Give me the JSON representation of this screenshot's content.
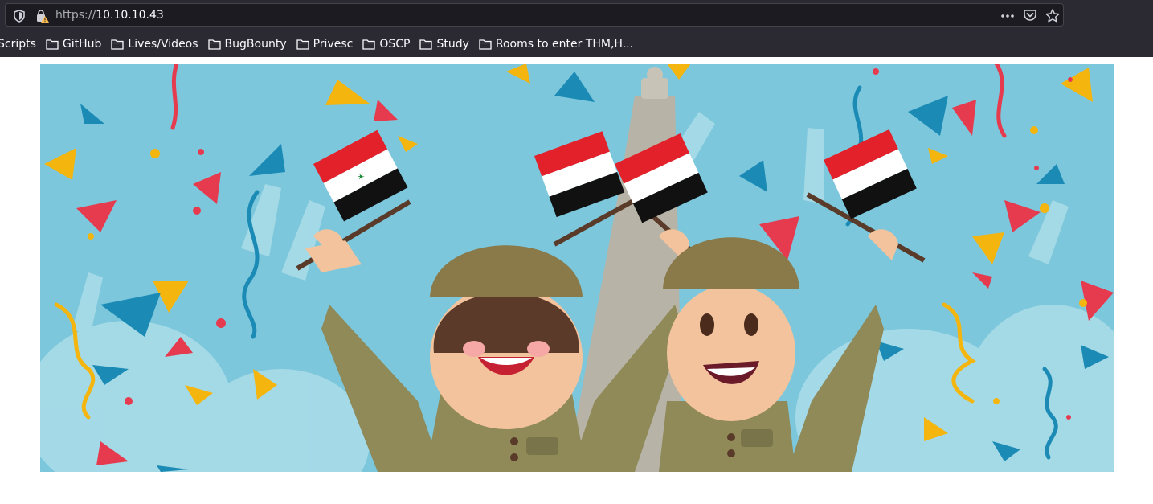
{
  "browser": {
    "url_scheme": "https://",
    "url_host": "10.10.10.43",
    "icons": [
      "shield-icon",
      "lock-warning-icon",
      "more-icon",
      "pocket-icon",
      "star-icon"
    ]
  },
  "bookmarks": [
    {
      "label": "Scripts",
      "icon": "none"
    },
    {
      "label": "GitHub",
      "icon": "folder-icon"
    },
    {
      "label": "Lives/Videos",
      "icon": "folder-icon"
    },
    {
      "label": "BugBounty",
      "icon": "folder-icon"
    },
    {
      "label": "Privesc",
      "icon": "folder-icon"
    },
    {
      "label": "OSCP",
      "icon": "folder-icon"
    },
    {
      "label": "Study",
      "icon": "folder-icon"
    },
    {
      "label": "Rooms to enter THM,H...",
      "icon": "folder-icon"
    }
  ],
  "hero": {
    "image": "celebration-illustration",
    "colors": {
      "sky": "#7cc7dc",
      "uniform": "#8f8a58",
      "flag_red": "#e2212a",
      "flag_black": "#111111",
      "confetti_yellow": "#f5b50f",
      "confetti_blue": "#1b8bb6"
    }
  }
}
